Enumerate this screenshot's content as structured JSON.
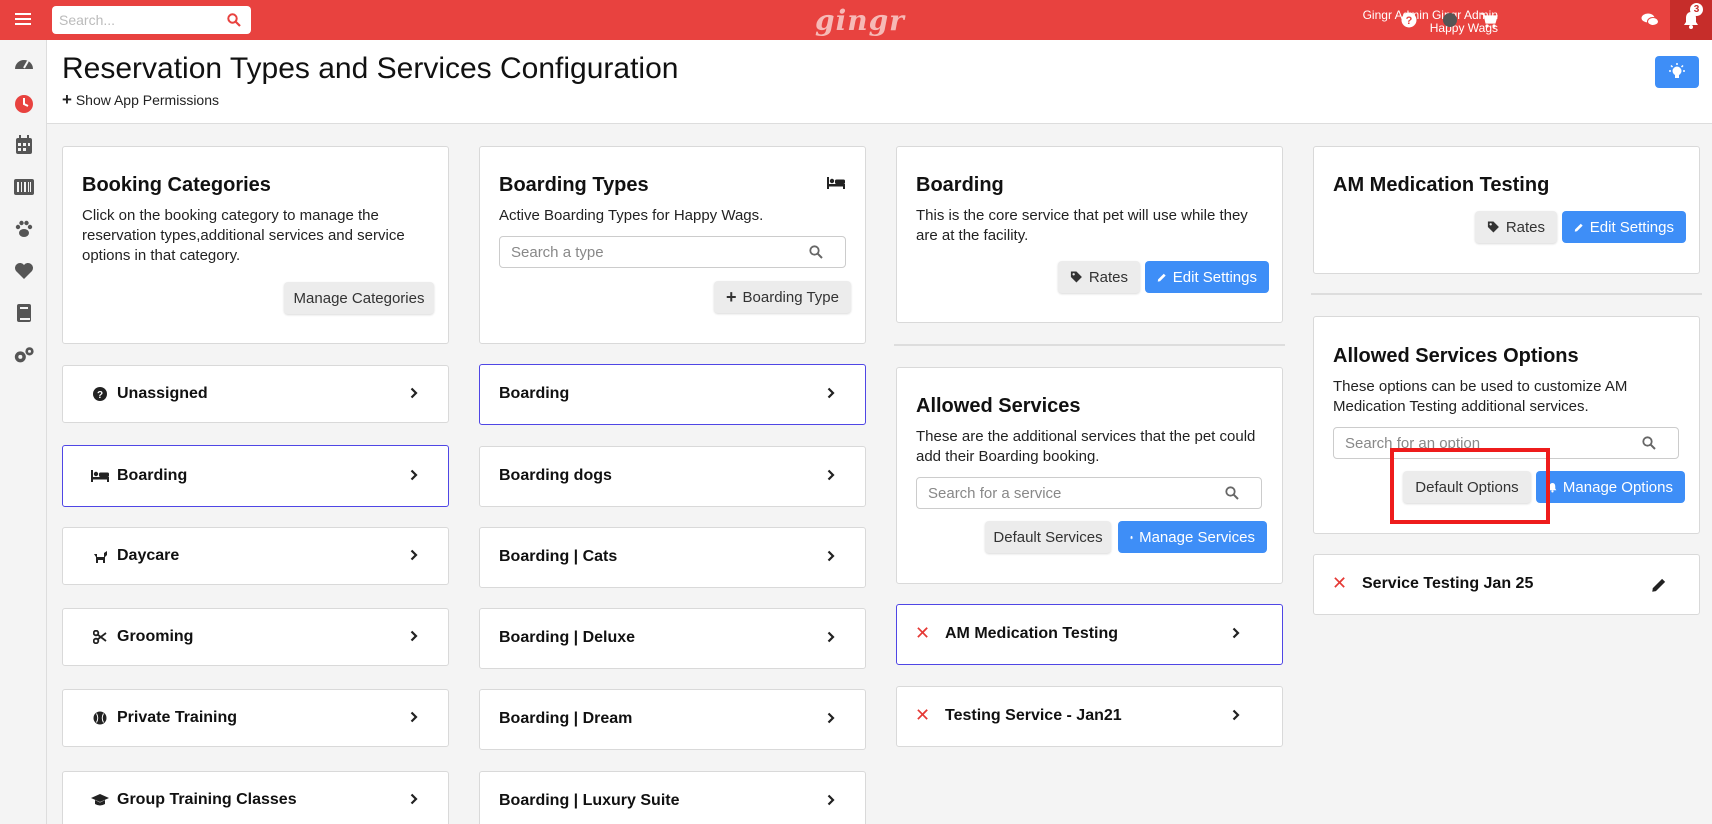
{
  "topbar": {
    "search_placeholder": "Search...",
    "logo": "gingr",
    "user_name": "Gingr Admin Gingr Admin",
    "location": "Happy Wags",
    "notification_count": "3"
  },
  "header": {
    "title": "Reservation Types and Services Configuration",
    "permissions_link": "Show App Permissions"
  },
  "booking_categories": {
    "title": "Booking Categories",
    "description": "Click on the booking category to manage the reservation types,additional services and service options in that category.",
    "manage_button": "Manage Categories",
    "items": [
      {
        "label": "Unassigned",
        "icon": "question-circle-icon"
      },
      {
        "label": "Boarding",
        "icon": "bed-icon"
      },
      {
        "label": "Daycare",
        "icon": "dog-icon"
      },
      {
        "label": "Grooming",
        "icon": "scissors-icon"
      },
      {
        "label": "Private Training",
        "icon": "baseball-icon"
      },
      {
        "label": "Group Training Classes",
        "icon": "graduation-cap-icon"
      }
    ]
  },
  "boarding_types": {
    "title": "Boarding Types",
    "description": "Active Boarding Types for Happy Wags.",
    "search_placeholder": "Search a type",
    "add_button": "Boarding Type",
    "items": [
      "Boarding",
      "Boarding dogs",
      "Boarding | Cats",
      "Boarding | Deluxe",
      "Boarding | Dream",
      "Boarding | Luxury Suite"
    ]
  },
  "boarding": {
    "title": "Boarding",
    "description": "This is the core service that pet will use while they are at the facility.",
    "rates_button": "Rates",
    "edit_button": "Edit Settings"
  },
  "allowed_services": {
    "title": "Allowed Services",
    "description": "These are the additional services that the pet could add their Boarding booking.",
    "search_placeholder": "Search for a service",
    "default_button": "Default Services",
    "manage_button": "Manage Services",
    "items": [
      "AM Medication Testing",
      "Testing Service - Jan21"
    ]
  },
  "am_medication": {
    "title": "AM Medication Testing",
    "rates_button": "Rates",
    "edit_button": "Edit Settings"
  },
  "allowed_options": {
    "title": "Allowed Services Options",
    "description": "These options can be used to customize AM Medication Testing additional services.",
    "search_placeholder": "Search for an option",
    "default_button": "Default Options",
    "manage_button": "Manage Options",
    "items": [
      "Service Testing Jan 25"
    ]
  },
  "colors": {
    "brand_red": "#e8423f",
    "primary_blue": "#3e8ef7",
    "selected_border": "#4f46e5",
    "delete_red": "#e53935"
  }
}
